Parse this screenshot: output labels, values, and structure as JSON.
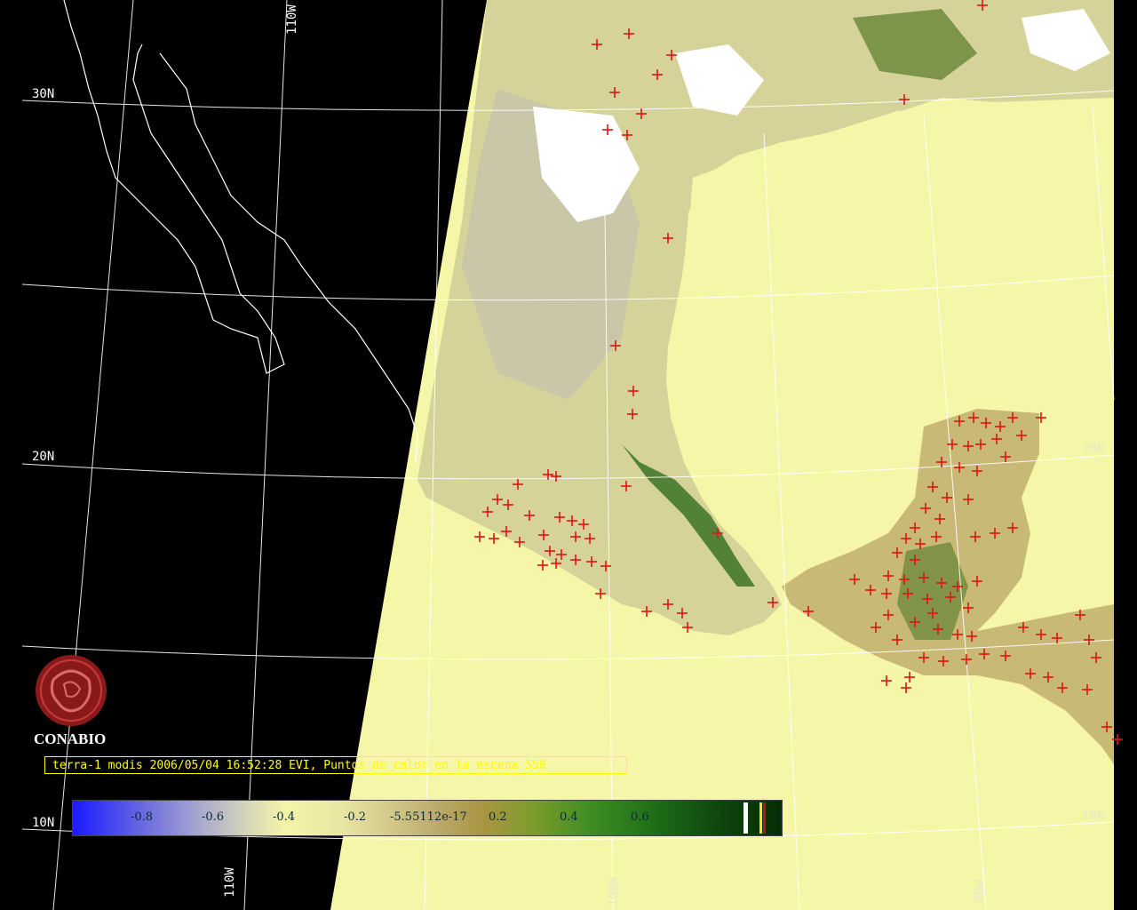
{
  "caption": "terra-1 modis 2006/05/04 16:52:28 EVI, Puntos de calor en la escena 550",
  "logo_text": "CONABIO",
  "grid_labels": {
    "lat_30": "30N",
    "lat_20": "20N",
    "lat_20_right": "20N",
    "lat_10": "10N",
    "lat_10_right": "10N",
    "lon_110_top": "110W",
    "lon_110_bottom": "110W",
    "lon_100": "100W",
    "lon_90": "90W"
  },
  "colorbar": {
    "ticks": [
      "-0.8",
      "-0.6",
      "-0.4",
      "-0.2",
      "-5.55112e-17",
      "0.2",
      "0.4",
      "0.6",
      "0.8"
    ]
  },
  "colors": {
    "background": "#000000",
    "ocean_fill": "#f6f6a8",
    "land_veg": "#c9bf78",
    "fire_marker": "#e01414",
    "caption_text": "#ffff00"
  }
}
